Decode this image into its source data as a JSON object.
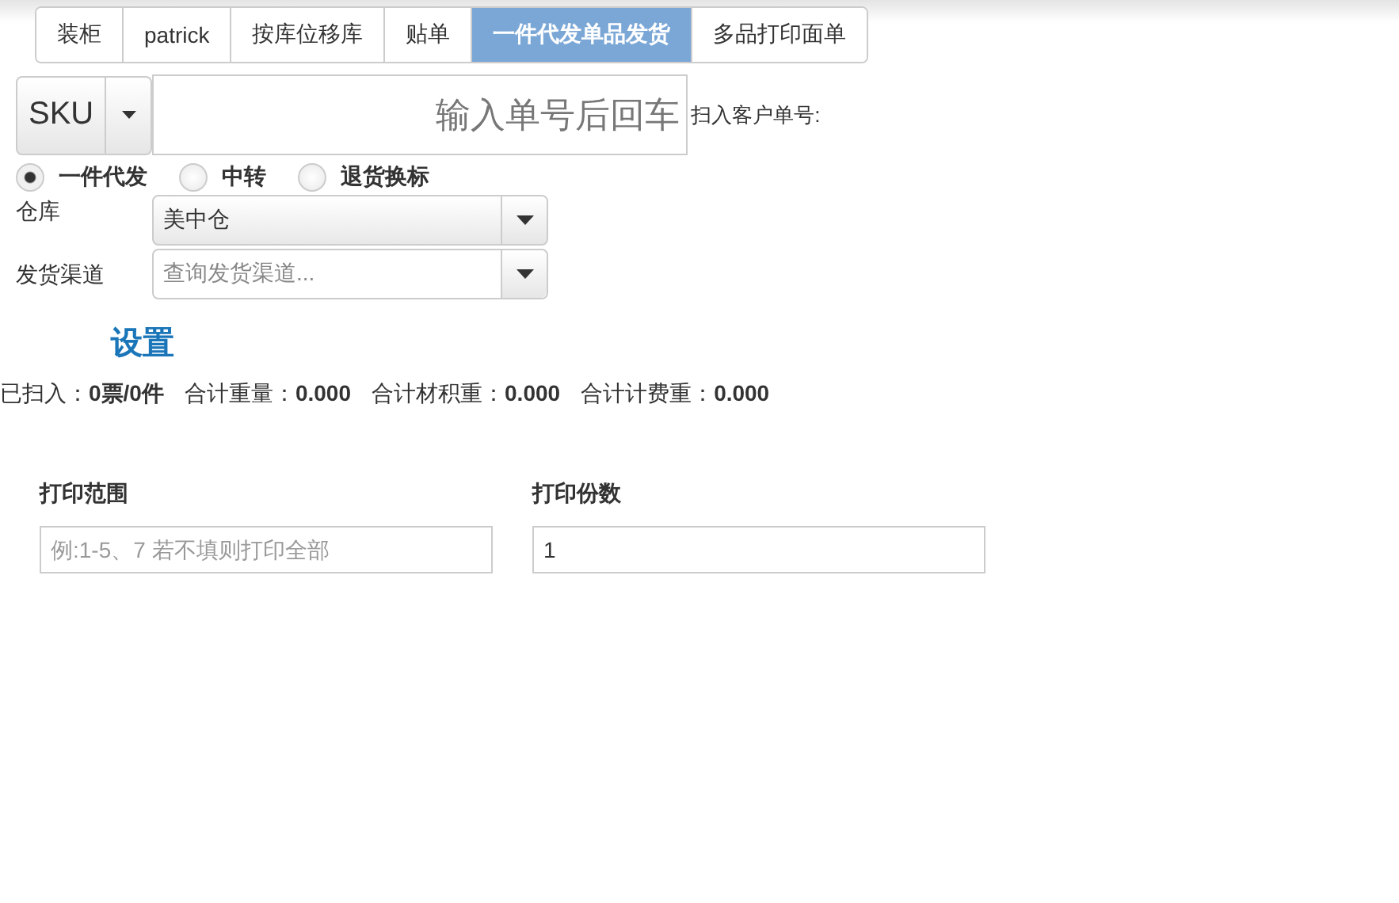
{
  "tabs": [
    {
      "label": "装柜",
      "selected": false
    },
    {
      "label": "patrick",
      "selected": false
    },
    {
      "label": "按库位移库",
      "selected": false
    },
    {
      "label": "贴单",
      "selected": false
    },
    {
      "label": "一件代发单品发货",
      "selected": true
    },
    {
      "label": "多品打印面单",
      "selected": false
    }
  ],
  "scan": {
    "type_button": "SKU",
    "placeholder": "输入单号后回车",
    "label": "扫入客户单号:"
  },
  "modes": [
    {
      "label": "一件代发",
      "selected": true
    },
    {
      "label": "中转",
      "selected": false
    },
    {
      "label": "退货换标",
      "selected": false
    }
  ],
  "warehouse": {
    "label": "仓库",
    "value": "美中仓"
  },
  "channel": {
    "label": "发货渠道",
    "placeholder": "查询发货渠道..."
  },
  "settings_title": "设置",
  "stats": [
    {
      "label": "已扫入：",
      "value": "0票/0件"
    },
    {
      "label": "合计重量：",
      "value": "0.000"
    },
    {
      "label": "合计材积重：",
      "value": "0.000"
    },
    {
      "label": "合计计费重：",
      "value": "0.000"
    }
  ],
  "print": [
    {
      "label": "打印范围",
      "placeholder": "例:1-5、7 若不填则打印全部"
    },
    {
      "label": "打印份数",
      "value": "1"
    }
  ]
}
